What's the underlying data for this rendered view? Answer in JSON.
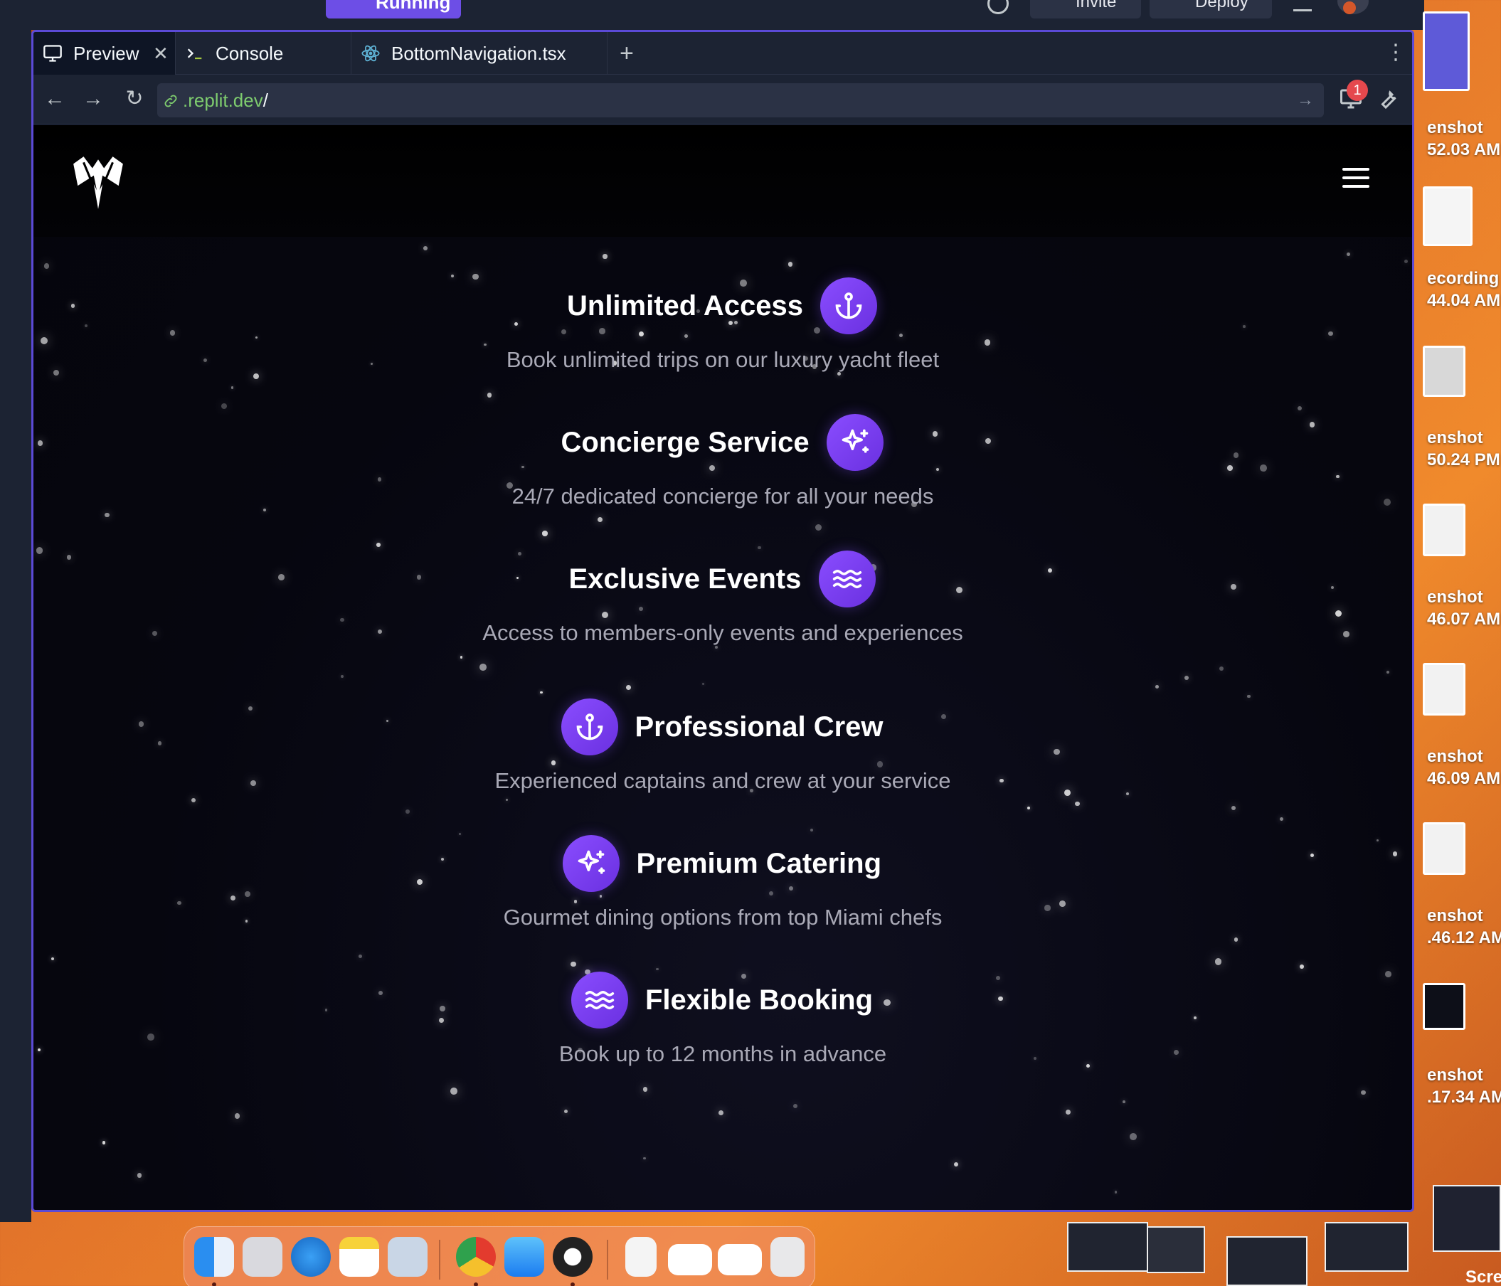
{
  "replit": {
    "run_status": "Running",
    "invite_label": "Invite",
    "deploy_label": "Deploy"
  },
  "tabs": [
    {
      "label": "Preview",
      "icon": "monitor-icon",
      "active": true
    },
    {
      "label": "Console",
      "icon": "terminal-icon",
      "active": false
    },
    {
      "label": "BottomNavigation.tsx",
      "icon": "react-icon",
      "active": false
    }
  ],
  "url": {
    "host": ".replit.dev",
    "path": "/"
  },
  "devtools_badge": "1",
  "site": {
    "features": [
      {
        "title": "Unlimited Access",
        "description": "Book unlimited trips on our luxury yacht fleet",
        "icon": "anchor-icon",
        "icon_side": "right"
      },
      {
        "title": "Concierge Service",
        "description": "24/7 dedicated concierge for all your needs",
        "icon": "sparkle-icon",
        "icon_side": "right"
      },
      {
        "title": "Exclusive Events",
        "description": "Access to members-only events and experiences",
        "icon": "waves-icon",
        "icon_side": "right"
      },
      {
        "title": "Professional Crew",
        "description": "Experienced captains and crew at your service",
        "icon": "anchor-icon",
        "icon_side": "left"
      },
      {
        "title": "Premium Catering",
        "description": "Gourmet dining options from top Miami chefs",
        "icon": "sparkle-icon",
        "icon_side": "left"
      },
      {
        "title": "Flexible Booking",
        "description": "Book up to 12 months in advance",
        "icon": "waves-icon",
        "icon_side": "left"
      }
    ]
  },
  "desktop": {
    "items": [
      {
        "line1": "enshot",
        "line2": "52.03 AM"
      },
      {
        "line1": "ecording",
        "line2": "44.04 AM"
      },
      {
        "line1": "enshot",
        "line2": "50.24 PM"
      },
      {
        "line1": "enshot",
        "line2": "46.07 AM"
      },
      {
        "line1": "enshot",
        "line2": "46.09 AM"
      },
      {
        "line1": "enshot",
        "line2": ".46.12 AM"
      },
      {
        "line1": "enshot",
        "line2": ".17.34 AM"
      }
    ],
    "bottom_label": "Scre"
  },
  "colors": {
    "accent": "#6d4ee6",
    "icon_gradient_start": "#8a4dff",
    "icon_gradient_end": "#6a30e0",
    "url_host": "#7ecc6e"
  }
}
